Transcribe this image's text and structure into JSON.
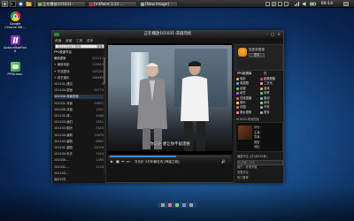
{
  "topbar": {
    "tasks": [
      {
        "label": "正在播放101031-",
        "color": "#66bb55"
      },
      {
        "label": "[mtPaint 3.31 ...",
        "color": "#d24"
      },
      {
        "label": "[New Image]",
        "color": "#7ab"
      }
    ],
    "clock": "00:14"
  },
  "desktop": {
    "icons": [
      {
        "label": "Google Chrome Wil...",
        "color": "#e33"
      },
      {
        "label": "AptanaRadRail 8",
        "color": "#8a2be2"
      },
      {
        "label": "PPStream",
        "color": "#3c9"
      }
    ]
  },
  "window": {
    "title": "正在播放101031-非诚勿扰",
    "top_tabs": [
      "频道",
      "收藏",
      "工具",
      "菜单"
    ],
    "search_placeholder": "共212158个视频",
    "search_btn": "搜索",
    "left_list": [
      {
        "label": "PPS频道节目",
        "count": "",
        "type": "hdr"
      },
      {
        "label": "最新更新",
        "count": "222217",
        "type": "hdr"
      },
      {
        "label": "+ 最新电影",
        "count": "115813",
        "type": ""
      },
      {
        "label": "+ 华语剧场",
        "count": "100201",
        "type": ""
      },
      {
        "label": "+ 综艺娱乐",
        "count": "266465",
        "type": ""
      },
      {
        "label": "101101-遇见",
        "count": "3",
        "type": ""
      },
      {
        "label": "101104-蒙面",
        "count": "92775",
        "type": ""
      },
      {
        "label": "101030-非诚勿扰",
        "count": "",
        "type": "hl"
      },
      {
        "label": "101031-非诚",
        "count": "19831",
        "type": ""
      },
      {
        "label": "101030-非诚",
        "count": "1201",
        "type": ""
      },
      {
        "label": "101102-绿...",
        "count": "4088",
        "type": ""
      },
      {
        "label": "101103-我们",
        "count": "1851",
        "type": ""
      },
      {
        "label": "101104-国光",
        "count": "3325",
        "type": ""
      },
      {
        "label": "101104-康熙",
        "count": "11876",
        "type": ""
      },
      {
        "label": "101103-康熙",
        "count": "5862",
        "type": ""
      },
      {
        "label": "101101-康熙",
        "count": "12076",
        "type": ""
      },
      {
        "label": "101104-天天",
        "count": "5318",
        "type": ""
      },
      {
        "label": "101030-...",
        "count": "1085",
        "type": ""
      },
      {
        "label": "101031-...",
        "count": "1104",
        "type": ""
      },
      {
        "label": "101104-...",
        "count": "",
        "type": ""
      }
    ],
    "left_bottom": "播放列表",
    "video": {
      "subtitle": "你说呢 想让你不留遗憾",
      "now_playing": "万元价 3万年最佳内 [神盘之城]",
      "progress": 0.55,
      "controls": [
        "▶",
        "■",
        "⏮",
        "⏭",
        "🔊"
      ]
    },
    "right": {
      "greeting": "您还未登录",
      "member_btn": "登录",
      "tabs": [
        "PPS影视库",
        "热"
      ],
      "links": [
        {
          "label": "电影",
          "color": "#e94"
        },
        {
          "label": "欧美剧集",
          "color": "#e44"
        },
        {
          "label": "电视剧",
          "color": "#4ae"
        },
        {
          "label": "二次元",
          "color": "#e9c"
        },
        {
          "label": "动漫",
          "color": "#5c5"
        },
        {
          "label": "游戏",
          "color": "#fa3"
        },
        {
          "label": "综艺",
          "color": "#a6e"
        },
        {
          "label": "体育",
          "color": "#4c9"
        },
        {
          "label": "在线直播",
          "color": "#e55"
        },
        {
          "label": "原创",
          "color": "#6be"
        },
        {
          "label": "音乐",
          "color": "#fd4"
        },
        {
          "label": "资讯",
          "color": "#9c6"
        },
        {
          "label": "中国",
          "color": "#e66"
        },
        {
          "label": "汽车",
          "color": "#8ad"
        },
        {
          "label": "美女视频",
          "color": "#f7a"
        },
        {
          "label": "更多",
          "color": "#aaa"
        }
      ],
      "banner": "101030-非诚勿扰",
      "ad_lines": [
        "评分：",
        "主演：",
        "导演：",
        "类型：",
        "地区："
      ],
      "bottom_lines": [
        "播放评论 (共7/8535条)",
        "在此输入评论 ...",
        "用户：非常不错",
        "发表评论",
        "热门推荐"
      ]
    }
  }
}
